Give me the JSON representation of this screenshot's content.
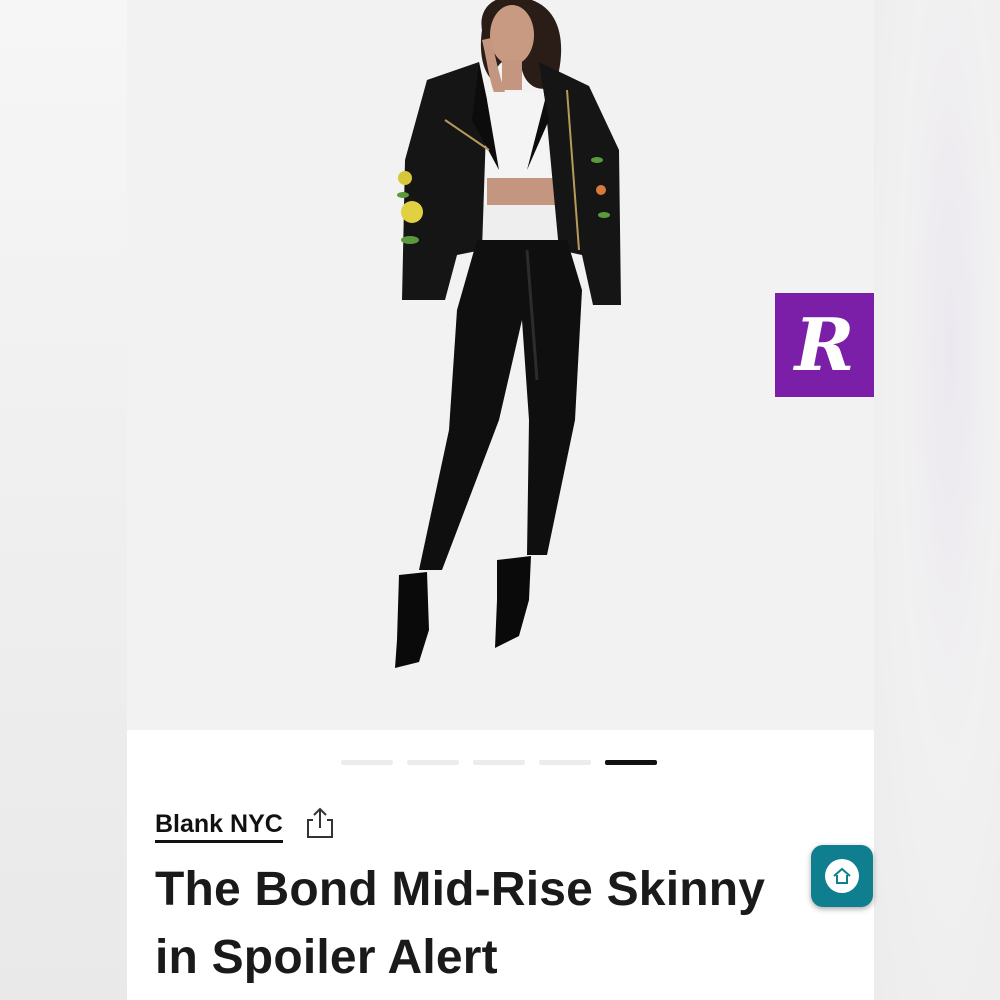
{
  "carousel": {
    "total": 5,
    "active_index": 4
  },
  "product": {
    "brand": "Blank NYC",
    "title_line1": "The Bond Mid-Rise Skinny",
    "title_line2": "in Spoiler Alert"
  },
  "badges": {
    "rakuten_letter": "R"
  },
  "icons": {
    "share": "share-icon",
    "home": "home-icon",
    "rakuten": "rakuten-logo-icon"
  },
  "colors": {
    "rakuten_purple": "#7b1fa8",
    "home_teal": "#0f7f8f",
    "active_dot": "#111111"
  }
}
